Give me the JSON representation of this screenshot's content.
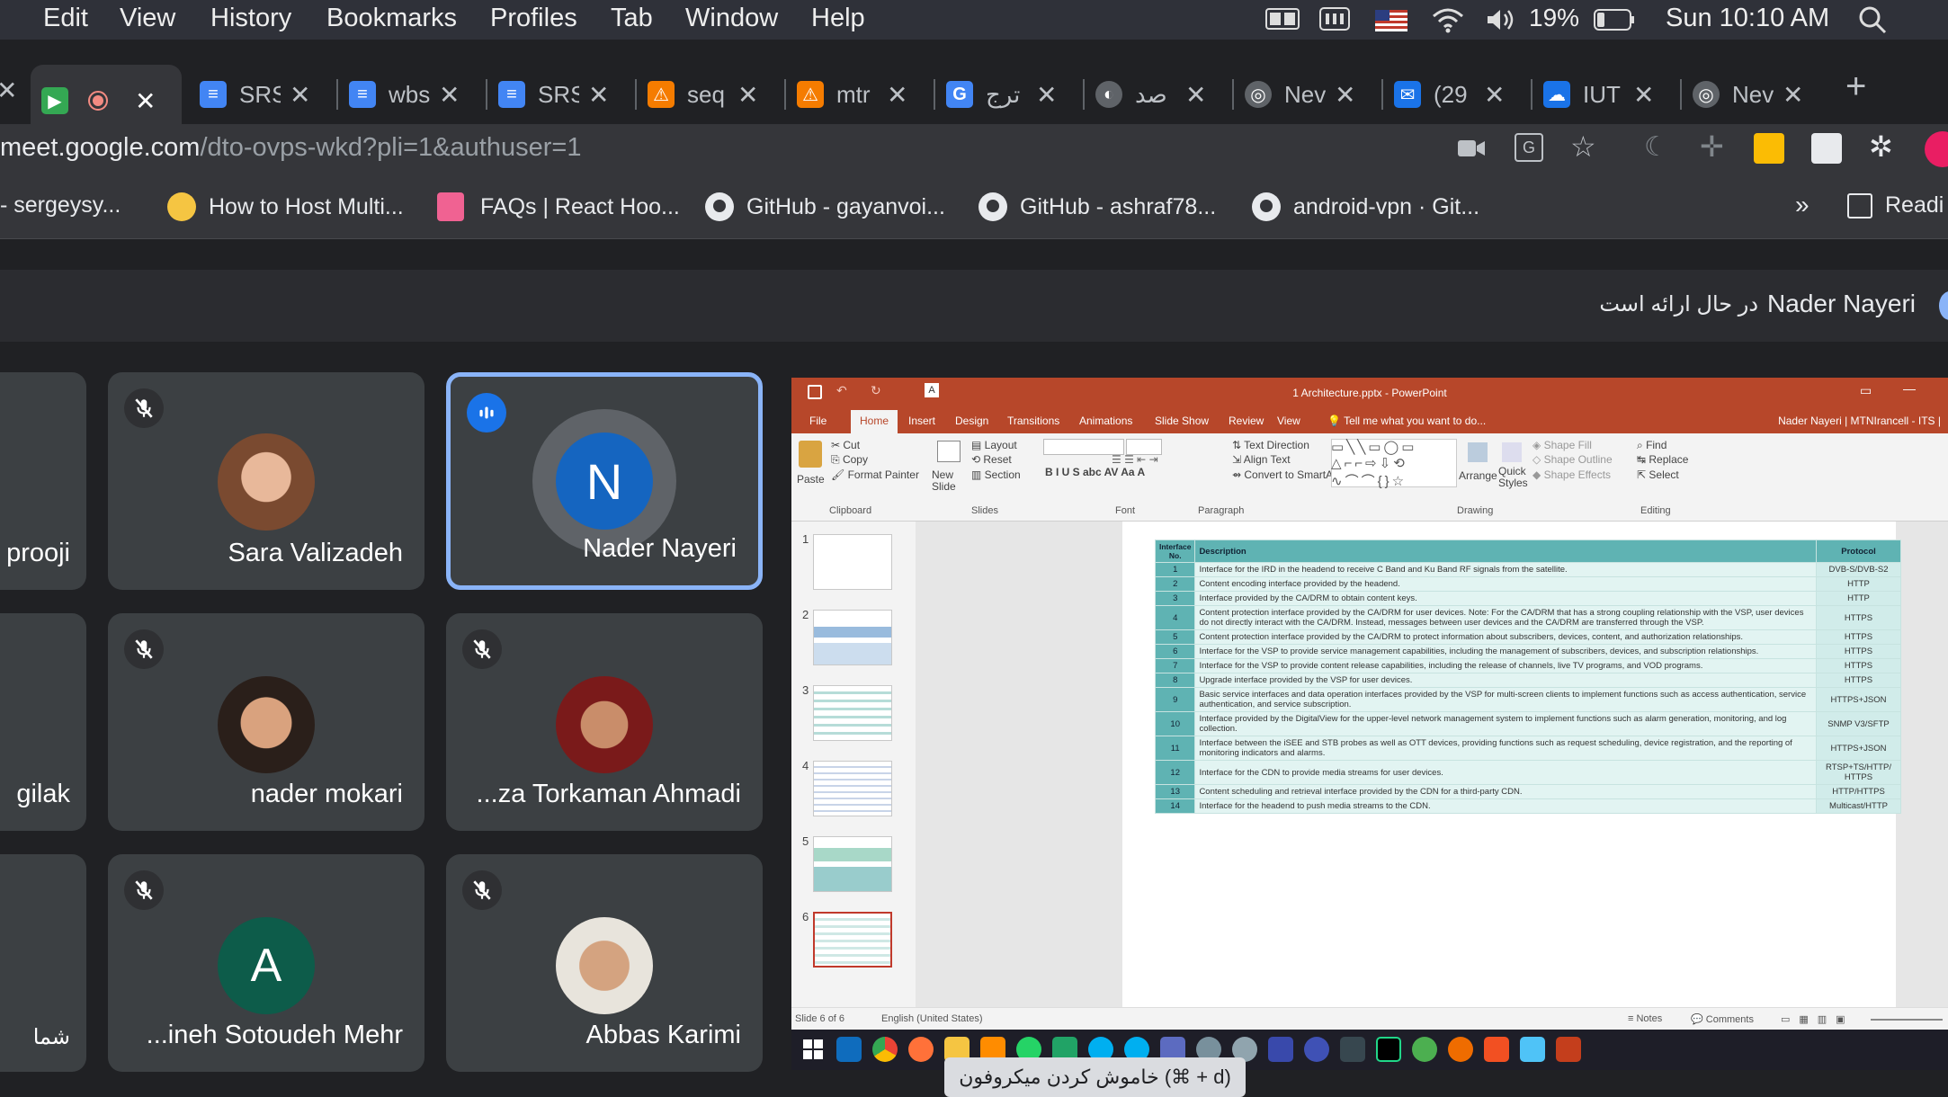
{
  "menubar": {
    "items": [
      "Edit",
      "View",
      "History",
      "Bookmarks",
      "Profiles",
      "Tab",
      "Window",
      "Help"
    ],
    "battery": "19%",
    "clock": "Sun 10:10 AM"
  },
  "tabs": [
    {
      "title": "",
      "color": "#34a853"
    },
    {
      "title": "SRS",
      "color": "#4285f4"
    },
    {
      "title": "wbs",
      "color": "#4285f4"
    },
    {
      "title": "SRS",
      "color": "#4285f4"
    },
    {
      "title": "seq",
      "color": "#f57c00"
    },
    {
      "title": "mtr",
      "color": "#f57c00"
    },
    {
      "title": "ترج",
      "color": "#4285f4"
    },
    {
      "title": "صد",
      "color": "#5f6368"
    },
    {
      "title": "Nev",
      "color": "#5f6368"
    },
    {
      "title": "(29",
      "color": "#1a73e8"
    },
    {
      "title": "IUT",
      "color": "#1a73e8"
    },
    {
      "title": "Nev",
      "color": "#5f6368"
    }
  ],
  "url": {
    "host": "meet.google.com",
    "path": "/dto-ovps-wkd?pli=1&authuser=1"
  },
  "bookmarks": [
    "- sergeysy...",
    "How to Host Multi...",
    "FAQs | React Hoo...",
    "GitHub - gayanvoi...",
    "GitHub - ashraf78...",
    "android-vpn · Git...",
    "Readi"
  ],
  "presenter": {
    "name": "Nader Nayeri",
    "suffix": "در حال ارائه است"
  },
  "participants": [
    {
      "name": "prooji",
      "initial": "",
      "muted": false
    },
    {
      "name": "Sara Valizadeh",
      "initial": "",
      "muted": true
    },
    {
      "name": "Nader Nayeri",
      "initial": "N",
      "muted": false
    },
    {
      "name": "gilak",
      "initial": "",
      "muted": false
    },
    {
      "name": "nader mokari",
      "initial": "",
      "muted": true
    },
    {
      "name": "...za Torkaman Ahmadi",
      "initial": "",
      "muted": true
    },
    {
      "name": "شما",
      "initial": "",
      "muted": false
    },
    {
      "name": "...ineh Sotoudeh Mehr",
      "initial": "A",
      "muted": true
    },
    {
      "name": "Abbas Karimi",
      "initial": "",
      "muted": true
    }
  ],
  "ppt": {
    "title": "1 Architecture.pptx - PowerPoint",
    "user": "Nader Nayeri | MTNIrancell - ITS |",
    "tabs": [
      "File",
      "Home",
      "Insert",
      "Design",
      "Transitions",
      "Animations",
      "Slide Show",
      "Review",
      "View",
      "Tell me what you want to do..."
    ],
    "groups": [
      "Clipboard",
      "Slides",
      "Font",
      "Paragraph",
      "Drawing",
      "Editing"
    ],
    "clipboard": [
      "Cut",
      "Copy",
      "Format Painter",
      "Paste"
    ],
    "slides_btns": [
      "Layout",
      "Reset",
      "Section",
      "New Slide"
    ],
    "para_btns": [
      "Text Direction",
      "Align Text",
      "Convert to SmartArt"
    ],
    "draw_btns": [
      "Arrange",
      "Quick Styles",
      "Shape Fill",
      "Shape Outline",
      "Shape Effects"
    ],
    "edit_btns": [
      "Find",
      "Replace",
      "Select"
    ],
    "slide_numbers": [
      "1",
      "2",
      "3",
      "4",
      "5",
      "6"
    ],
    "status": {
      "slide": "Slide 6 of 6",
      "lang": "English (United States)",
      "notes": "Notes",
      "comments": "Comments"
    },
    "table_headers": [
      "Interface No.",
      "Description",
      "Protocol"
    ],
    "table_rows": [
      {
        "no": "1",
        "desc": "Interface for the IRD in the headend to receive C Band and Ku Band RF signals from the satellite.",
        "proto": "DVB-S/DVB-S2"
      },
      {
        "no": "2",
        "desc": "Content encoding interface provided by the headend.",
        "proto": "HTTP"
      },
      {
        "no": "3",
        "desc": "Interface provided by the CA/DRM to obtain content keys.",
        "proto": "HTTP"
      },
      {
        "no": "4",
        "desc": "Content protection interface provided by the CA/DRM for user devices. Note: For the CA/DRM that has a strong coupling relationship with the VSP, user devices do not directly interact with the CA/DRM. Instead, messages between user devices and the CA/DRM are transferred through the VSP.",
        "proto": "HTTPS"
      },
      {
        "no": "5",
        "desc": "Content protection interface provided by the CA/DRM to protect information about subscribers, devices, content, and authorization relationships.",
        "proto": "HTTPS"
      },
      {
        "no": "6",
        "desc": "Interface for the VSP to provide service management capabilities, including the management of subscribers, devices, and subscription relationships.",
        "proto": "HTTPS"
      },
      {
        "no": "7",
        "desc": "Interface for the VSP to provide content release capabilities, including the release of channels, live TV programs, and VOD programs.",
        "proto": "HTTPS"
      },
      {
        "no": "8",
        "desc": "Upgrade interface provided by the VSP for user devices.",
        "proto": "HTTPS"
      },
      {
        "no": "9",
        "desc": "Basic service interfaces and data operation interfaces provided by the VSP for multi-screen clients to implement functions such as access authentication, service authentication, and service subscription.",
        "proto": "HTTPS+JSON"
      },
      {
        "no": "10",
        "desc": "Interface provided by the DigitalView for the upper-level network management system to implement functions such as alarm generation, monitoring, and log collection.",
        "proto": "SNMP V3/SFTP"
      },
      {
        "no": "11",
        "desc": "Interface between the iSEE and STB probes as well as OTT devices, providing functions such as request scheduling, device registration, and the reporting of monitoring indicators and alarms.",
        "proto": "HTTPS+JSON"
      },
      {
        "no": "12",
        "desc": "Interface for the CDN to provide media streams for user devices.",
        "proto": "RTSP+TS/HTTP/ HTTPS"
      },
      {
        "no": "13",
        "desc": "Content scheduling and retrieval interface provided by the CDN for a third-party CDN.",
        "proto": "HTTP/HTTPS"
      },
      {
        "no": "14",
        "desc": "Interface for the headend to push media streams to the CDN.",
        "proto": "Multicast/HTTP"
      }
    ]
  },
  "tooltip": "خاموش کردن میکروفون (⌘ + d)"
}
